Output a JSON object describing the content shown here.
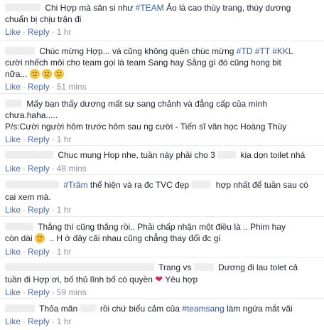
{
  "comments": [
    {
      "lines": [
        "Chi Hợp mà sân si như ",
        "#TEAM",
        " Ảo là cao thùy trang, thùy dương",
        "chuẩn bị chịu trận đi"
      ],
      "time": "1 hr"
    },
    {
      "lines": [
        "Chúc mừng Hợp... và cũng không quên chúc mừng ",
        "#TD",
        " ",
        "#TT",
        " ",
        "#KKL",
        "cười nhếch môi cho team gọi là team Sang hay Sằng gì đó cũng hong bit",
        "nữa..."
      ],
      "time": "51 mins"
    },
    {
      "lines": [
        "Mấy bạn thấy dương mất sự sang chảnh và đẳng cấp của mình",
        "chưa.haha.....",
        "P/s:Cười người hôm trước hôm sau ng cười - Tiến sĩ văn học Hoàng Thùy"
      ],
      "time": "1 hr"
    },
    {
      "lines": [
        "Chuc mung Hop nhe, tuần này phải cho 3 ",
        " kia dọn toilet nhá"
      ],
      "time": "48 mins"
    },
    {
      "lines": [
        "#Trâm",
        " thể hiện và ra đc TVC đẹp ",
        " hợp nhất để tuần sau có",
        "cai xem mà."
      ],
      "time": "1 hr"
    },
    {
      "lines": [
        "Thắng thì cũng thắng rồi.. Phải chấp nhận một điều là .. Phim hay",
        "còn dài ",
        " .. H ở đây cãi nhau cũng chẳng thay đổi đc gì"
      ],
      "time": "1 hr"
    },
    {
      "lines": [
        "Trang vs ",
        " Dương đi lau tolet cả",
        "tuần đi Hợp ơi, bố thủ lĩnh bố có quyền ",
        " Yêu hợp"
      ],
      "time": "59 mins"
    },
    {
      "lines": [
        "Thỏa mãn ",
        " rồi chứ biểu cảm của ",
        "#teamsang",
        " làm ngứa mắt vãi"
      ],
      "time": "1 hr"
    }
  ],
  "actions": {
    "like": "Like",
    "reply": "Reply",
    "separator": "·"
  }
}
